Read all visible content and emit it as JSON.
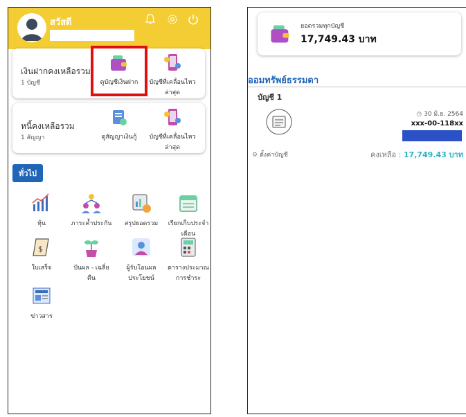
{
  "left": {
    "header": {
      "greeting": "สวัสดี",
      "icons": [
        "bell-icon",
        "gear-icon",
        "power-icon"
      ],
      "color": "#f3cd33"
    },
    "deposit_card": {
      "title": "เงินฝากคงเหลือรวม",
      "subtitle": "1 บัญชี",
      "actions": [
        {
          "label": "ดูบัญชีเงินฝาก",
          "highlighted": true
        },
        {
          "label1": "บัญชีที่เคลื่อนไหว",
          "label2": "ล่าสุด"
        }
      ]
    },
    "debt_card": {
      "title": "หนี้คงเหลือรวม",
      "subtitle": "1 สัญญา",
      "actions": [
        {
          "label": "ดูสัญญาเงินกู้"
        },
        {
          "label1": "บัญชีที่เคลื่อนไหว",
          "label2": "ล่าสุด"
        }
      ]
    },
    "section_label": "ทั่วไป",
    "grid": [
      {
        "label1": "หุ้น",
        "label2": ""
      },
      {
        "label1": "ภาระค้ำประกัน",
        "label2": ""
      },
      {
        "label1": "สรุปยอดรวม",
        "label2": ""
      },
      {
        "label1": "เรียกเก็บประจำ",
        "label2": "เดือน"
      },
      {
        "label1": "ใบเสร็จ",
        "label2": ""
      },
      {
        "label1": "ปันผล - เฉลี่ย",
        "label2": "คืน"
      },
      {
        "label1": "ผู้รับโอนผล",
        "label2": "ประโยชน์"
      },
      {
        "label1": "ตารางประมาณ",
        "label2": "การชำระ"
      },
      {
        "label1": "ข่าวสาร",
        "label2": ""
      }
    ]
  },
  "right": {
    "total": {
      "label": "ยอดรวมทุกบัญชี",
      "value": "17,749.43 บาท"
    },
    "section_title": "ออมทรัพย์ธรรมดา",
    "account": {
      "name": "บัญชี 1",
      "date": "30 มิ.ย. 2564",
      "number": "xxx-00-118xx",
      "settings_label": "ตั้งค่าบัญชี",
      "balance_label": "คงเหลือ :",
      "balance_value": "17,749.43 บาท"
    },
    "accent_color": "#1f66b9",
    "balance_color": "#2cb2c8"
  }
}
